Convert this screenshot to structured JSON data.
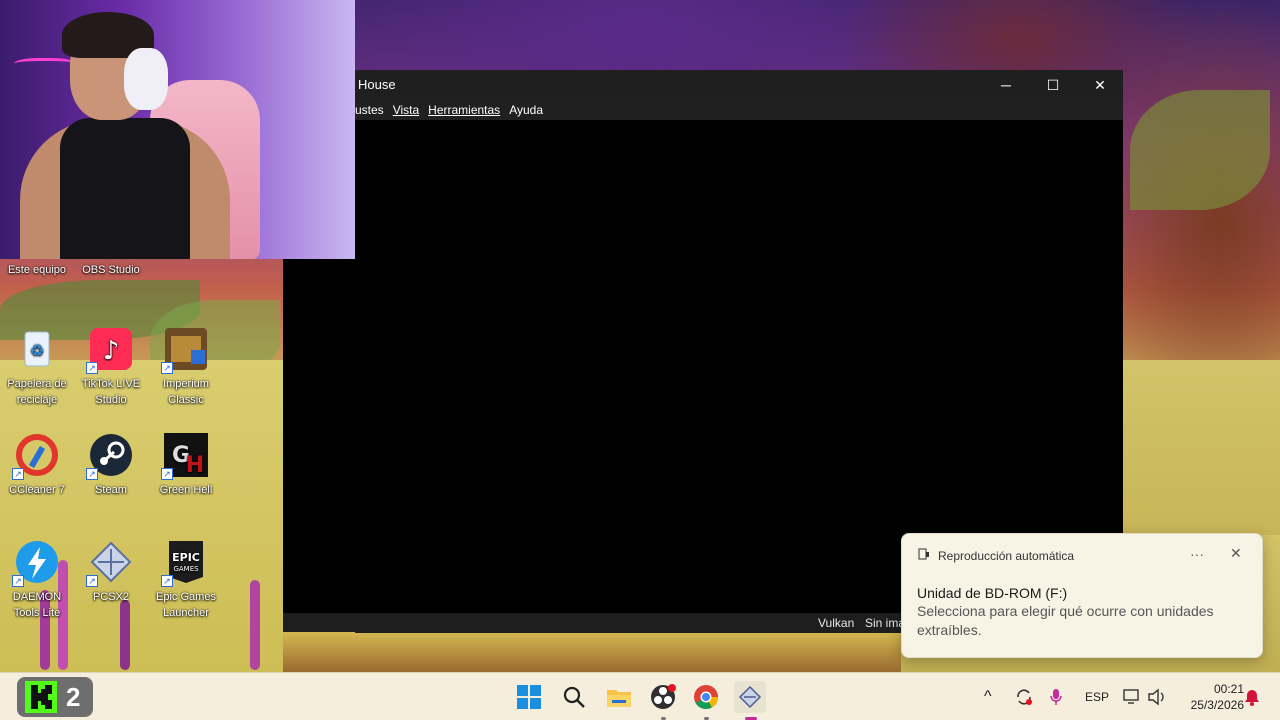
{
  "window": {
    "title": "House",
    "minimize_glyph": "─",
    "maximize_glyph": "☐",
    "close_glyph": "✕",
    "menu": [
      {
        "label": "ustes"
      },
      {
        "label": "Vista"
      },
      {
        "label": "Herramientas"
      },
      {
        "label": "Ayuda"
      }
    ],
    "status": {
      "renderer": "Vulkan",
      "image_info": "Sin ima"
    }
  },
  "desktop": {
    "icons": [
      {
        "label": "Este equipo"
      },
      {
        "label": "OBS Studio"
      },
      {
        "label": "Papelera de reciclaje"
      },
      {
        "label": "TikTok LIVE Studio"
      },
      {
        "label": "Imperium Classic"
      },
      {
        "label": "CCleaner 7"
      },
      {
        "label": "Steam"
      },
      {
        "label": "Green Hell"
      },
      {
        "label": "DAEMON Tools Lite"
      },
      {
        "label": "PCSX2"
      },
      {
        "label": "Epic Games Launcher"
      }
    ]
  },
  "notification": {
    "header": "Reproducción automática",
    "more_glyph": "···",
    "close_glyph": "✕",
    "title": "Unidad de BD-ROM (F:)",
    "body": "Selecciona para elegir qué ocurre con unidades extraíbles."
  },
  "taskbar": {
    "widget_text": "2",
    "tray": {
      "language": "ESP",
      "chevron": "^"
    },
    "clock": {
      "time": "00:21",
      "date": "25/3/2026"
    }
  },
  "colors": {
    "window_titlebar": "#1f1f1f",
    "taskbar": "#f5eedc",
    "toast": "#f7f4e6",
    "notification_badge": "#d1143a"
  },
  "icons": {
    "start": "windows-start-icon",
    "search": "search-icon",
    "explorer": "file-explorer-icon",
    "obs": "obs-icon",
    "chrome": "chrome-icon",
    "pcsx2": "pcsx2-icon"
  }
}
